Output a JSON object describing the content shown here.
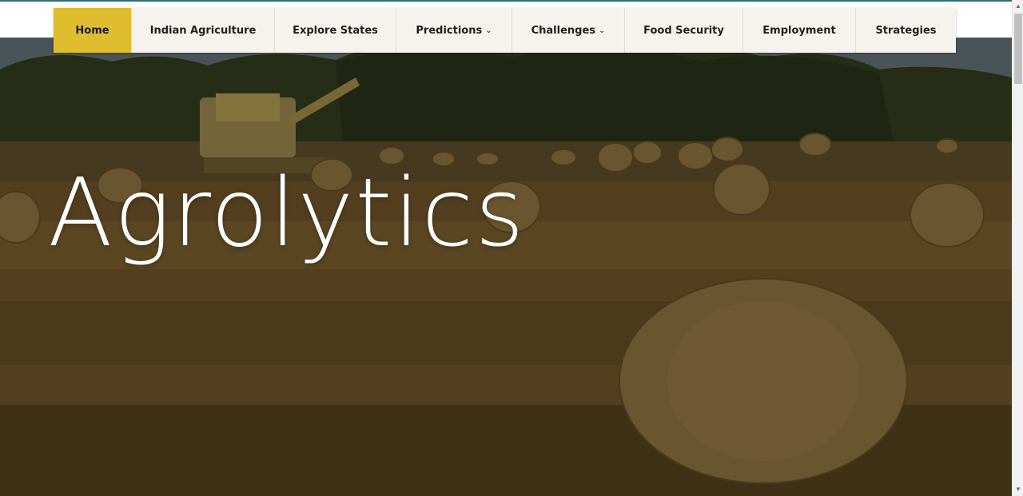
{
  "hero": {
    "title": "Agrolytics"
  },
  "nav": {
    "items": [
      {
        "label": "Home",
        "active": true,
        "dropdown": false
      },
      {
        "label": "Indian Agriculture",
        "active": false,
        "dropdown": false
      },
      {
        "label": "Explore States",
        "active": false,
        "dropdown": false
      },
      {
        "label": "Predictions",
        "active": false,
        "dropdown": true
      },
      {
        "label": "Challenges",
        "active": false,
        "dropdown": true
      },
      {
        "label": "Food Security",
        "active": false,
        "dropdown": false
      },
      {
        "label": "Employment",
        "active": false,
        "dropdown": false
      },
      {
        "label": "Strategies",
        "active": false,
        "dropdown": false
      }
    ]
  },
  "colors": {
    "accent": "#e0bd2e",
    "nav_bg": "#f6f3ee",
    "title": "#ffffff"
  },
  "icons": {
    "dropdown": "chevron-down-icon"
  }
}
